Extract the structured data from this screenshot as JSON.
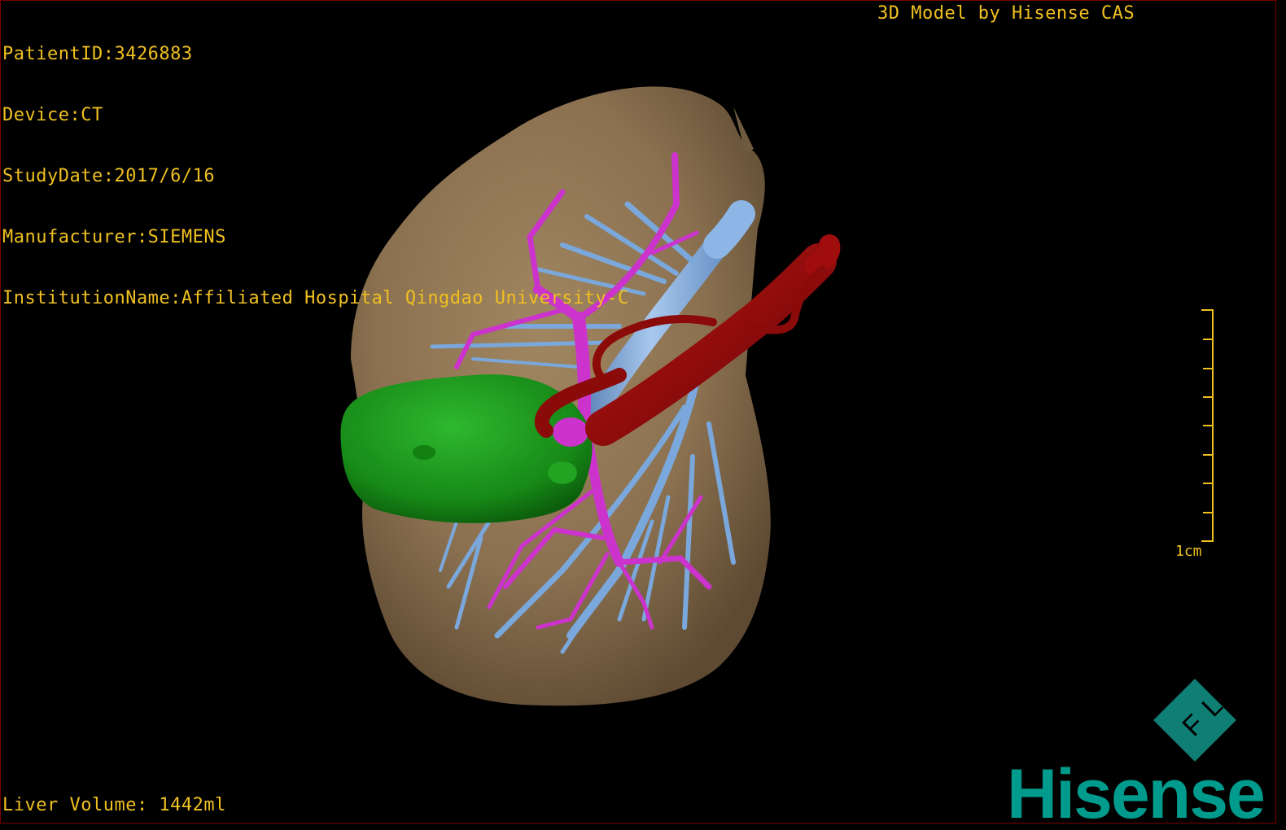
{
  "overlay": {
    "patient_id": "PatientID:3426883",
    "device": "Device:CT",
    "study_date": "StudyDate:2017/6/16",
    "manufacturer": "Manufacturer:SIEMENS",
    "institution": "InstitutionName:Affiliated Hospital Qingdao University-C",
    "model_credit": "3D Model by Hisense CAS",
    "liver_volume": "Liver Volume: 1442ml"
  },
  "scale_bar": {
    "label": "1cm"
  },
  "logo": {
    "word": "Hisense",
    "emblem": "FL"
  },
  "colors": {
    "overlay_text": "#f0c020",
    "liver": "#8b7150",
    "tumor": "#1a8f1a",
    "portal_vein": "#cc33cc",
    "hepatic_vein": "#7aa8dc",
    "artery": "#8b0a0a",
    "brand": "#009b8c"
  }
}
